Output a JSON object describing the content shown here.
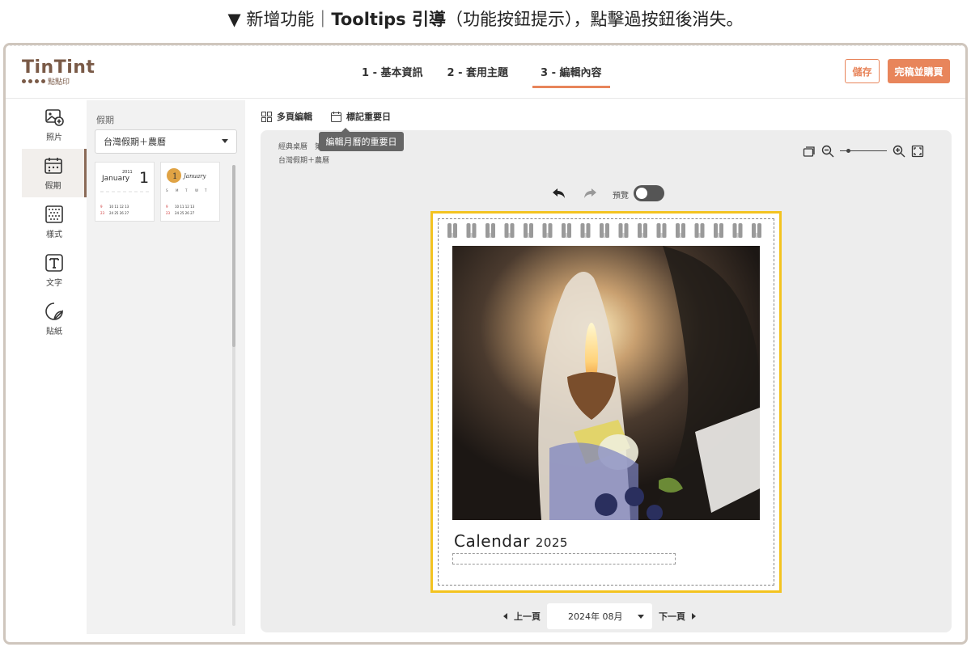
{
  "caption": {
    "prefix": "▼ 新增功能｜",
    "bold": "Tooltips 引導",
    "suffix": "（功能按鈕提示），點擊過按鈕後消失。"
  },
  "logo": {
    "main": "TinTint",
    "sub": "點點印"
  },
  "steps": [
    {
      "label": "1 - 基本資訊",
      "active": false
    },
    {
      "label": "2 - 套用主題",
      "active": false
    },
    {
      "label": "3 - 編輯內容",
      "active": true
    }
  ],
  "header_buttons": {
    "save": "儲存",
    "buy": "完稿並購買"
  },
  "sidebar": {
    "items": [
      {
        "label": "照片",
        "icon": "photo-add-icon"
      },
      {
        "label": "假期",
        "icon": "calendar-icon",
        "active": true
      },
      {
        "label": "樣式",
        "icon": "pattern-icon"
      },
      {
        "label": "文字",
        "icon": "text-icon"
      },
      {
        "label": "貼紙",
        "icon": "sticker-icon"
      }
    ]
  },
  "panel": {
    "title": "假期",
    "select_value": "台灣假期＋農曆",
    "thumb1": {
      "year": "2011",
      "month": "January",
      "day": "1",
      "dates": "9 10 11 12 13",
      "dates2": "23 24 25 26 27"
    },
    "thumb2": {
      "day": "1",
      "month": "January",
      "dates": "9 10 11 12 13",
      "dates2": "23 24 25 26 27"
    }
  },
  "toolbar": {
    "multi_edit": "多頁編輯",
    "mark_dates": "標記重要日",
    "tooltip": "編輯月曆的重要日"
  },
  "canvas": {
    "breadcrumb_1": "經典桌曆",
    "breadcrumb_1b": "第",
    "breadcrumb_2": "台灣假期＋農曆",
    "preview_label": "預覽",
    "calendar_title": "Calendar",
    "calendar_year": "2025"
  },
  "pager": {
    "prev": "上一頁",
    "current": "2024年 08月",
    "next": "下一頁"
  }
}
